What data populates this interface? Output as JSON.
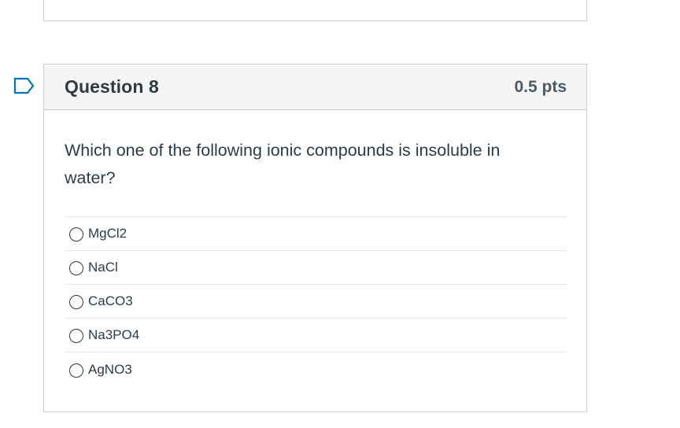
{
  "question": {
    "title": "Question 8",
    "points": "0.5 pts",
    "text": "Which one of the following ionic compounds is insoluble in water?",
    "answers": [
      {
        "label": "MgCl2",
        "selected": false
      },
      {
        "label": "NaCl",
        "selected": false
      },
      {
        "label": "CaCO3",
        "selected": false
      },
      {
        "label": "Na3PO4",
        "selected": false
      },
      {
        "label": "AgNO3",
        "selected": false
      }
    ]
  },
  "icons": {
    "flag": "bookmark-flag-icon"
  },
  "colors": {
    "accent": "#0374b5",
    "text": "#2d3b45",
    "border": "#c7cdd1",
    "header_bg": "#f5f5f5"
  }
}
